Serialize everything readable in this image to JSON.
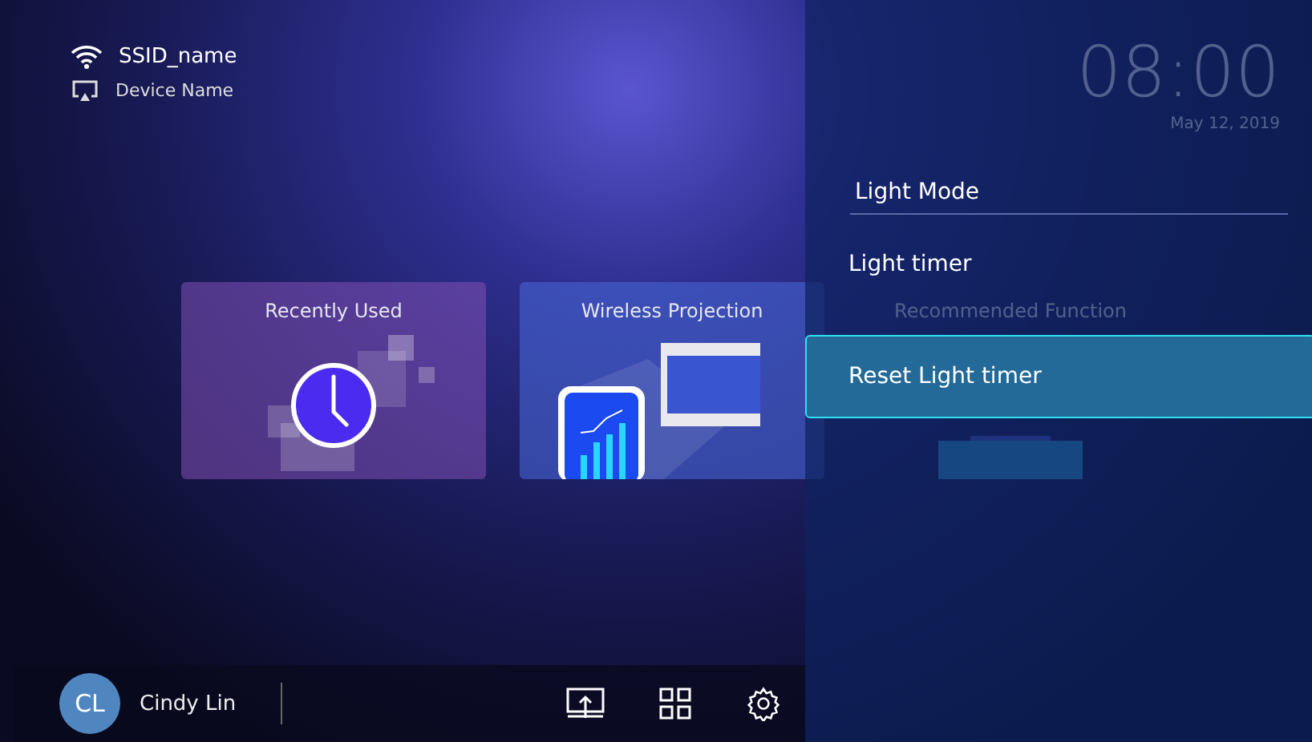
{
  "status": {
    "ssid": "SSID_name",
    "device": "Device Name"
  },
  "clock": {
    "time": "08:00",
    "date": "May 12, 2019"
  },
  "cards": [
    {
      "title": "Recently Used",
      "kind": "recent"
    },
    {
      "title": "Wireless Projection",
      "kind": "wireless"
    },
    {
      "title": "Recommended Function",
      "kind": "recommended"
    }
  ],
  "user": {
    "initials": "CL",
    "name": "Cindy Lin"
  },
  "dock": [
    {
      "kind": "cast"
    },
    {
      "kind": "apps"
    },
    {
      "kind": "settings"
    }
  ],
  "menu": {
    "title": "Light Mode",
    "items": [
      {
        "label": "Light timer",
        "selected": false
      },
      {
        "label": "Reset Light timer",
        "selected": true
      }
    ]
  }
}
